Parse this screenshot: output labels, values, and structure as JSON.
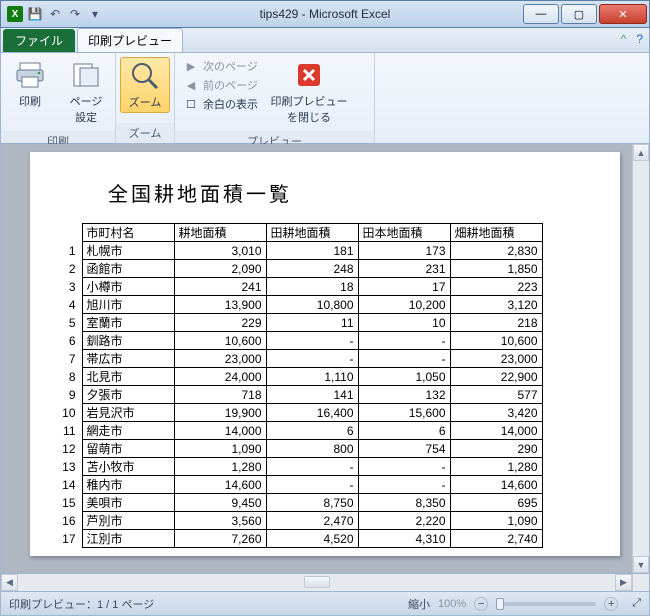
{
  "window": {
    "title": "tips429 - Microsoft Excel"
  },
  "qat": {
    "item1": "save-icon",
    "item2": "undo-icon",
    "item3": "redo-icon"
  },
  "tabs": {
    "file": "ファイル",
    "active": "印刷プレビュー"
  },
  "ribbon": {
    "print": {
      "label": "印刷",
      "print_btn": "印刷",
      "page_setup_btn": "ページ\n設定"
    },
    "zoom": {
      "label": "ズーム",
      "zoom_btn": "ズーム"
    },
    "preview": {
      "label": "プレビュー",
      "next_page": "次のページ",
      "prev_page": "前のページ",
      "show_margins": "余白の表示",
      "close": "印刷プレビュー\nを閉じる"
    }
  },
  "document": {
    "title": "全国耕地面積一覧",
    "columns": [
      "市町村名",
      "耕地面積",
      "田耕地面積",
      "田本地面積",
      "畑耕地面積"
    ],
    "rows": [
      {
        "n": "1",
        "name": "札幌市",
        "c1": "3,010",
        "c2": "181",
        "c3": "173",
        "c4": "2,830"
      },
      {
        "n": "2",
        "name": "函館市",
        "c1": "2,090",
        "c2": "248",
        "c3": "231",
        "c4": "1,850"
      },
      {
        "n": "3",
        "name": "小樽市",
        "c1": "241",
        "c2": "18",
        "c3": "17",
        "c4": "223"
      },
      {
        "n": "4",
        "name": "旭川市",
        "c1": "13,900",
        "c2": "10,800",
        "c3": "10,200",
        "c4": "3,120"
      },
      {
        "n": "5",
        "name": "室蘭市",
        "c1": "229",
        "c2": "11",
        "c3": "10",
        "c4": "218"
      },
      {
        "n": "6",
        "name": "釧路市",
        "c1": "10,600",
        "c2": "-",
        "c3": "-",
        "c4": "10,600"
      },
      {
        "n": "7",
        "name": "帯広市",
        "c1": "23,000",
        "c2": "-",
        "c3": "-",
        "c4": "23,000"
      },
      {
        "n": "8",
        "name": "北見市",
        "c1": "24,000",
        "c2": "1,110",
        "c3": "1,050",
        "c4": "22,900"
      },
      {
        "n": "9",
        "name": "夕張市",
        "c1": "718",
        "c2": "141",
        "c3": "132",
        "c4": "577"
      },
      {
        "n": "10",
        "name": "岩見沢市",
        "c1": "19,900",
        "c2": "16,400",
        "c3": "15,600",
        "c4": "3,420"
      },
      {
        "n": "11",
        "name": "網走市",
        "c1": "14,000",
        "c2": "6",
        "c3": "6",
        "c4": "14,000"
      },
      {
        "n": "12",
        "name": "留萌市",
        "c1": "1,090",
        "c2": "800",
        "c3": "754",
        "c4": "290"
      },
      {
        "n": "13",
        "name": "苫小牧市",
        "c1": "1,280",
        "c2": "-",
        "c3": "-",
        "c4": "1,280"
      },
      {
        "n": "14",
        "name": "稚内市",
        "c1": "14,600",
        "c2": "-",
        "c3": "-",
        "c4": "14,600"
      },
      {
        "n": "15",
        "name": "美唄市",
        "c1": "9,450",
        "c2": "8,750",
        "c3": "8,350",
        "c4": "695"
      },
      {
        "n": "16",
        "name": "芦別市",
        "c1": "3,560",
        "c2": "2,470",
        "c3": "2,220",
        "c4": "1,090"
      },
      {
        "n": "17",
        "name": "江別市",
        "c1": "7,260",
        "c2": "4,520",
        "c3": "4,310",
        "c4": "2,740"
      }
    ]
  },
  "status": {
    "text": "印刷プレビュー：1 / 1 ページ",
    "zoom_label": "縮小",
    "zoom_pct": "100%"
  }
}
